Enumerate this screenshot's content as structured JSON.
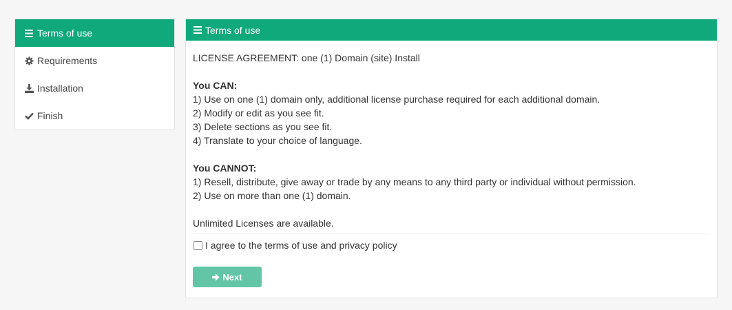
{
  "sidebar": {
    "items": [
      {
        "label": "Terms of use",
        "icon": "menu-icon",
        "active": true
      },
      {
        "label": "Requirements",
        "icon": "gear-icon",
        "active": false
      },
      {
        "label": "Installation",
        "icon": "download-icon",
        "active": false
      },
      {
        "label": "Finish",
        "icon": "check-icon",
        "active": false
      }
    ]
  },
  "panel": {
    "title": "Terms of use",
    "intro": "LICENSE AGREEMENT: one (1) Domain (site) Install",
    "can": {
      "heading": "You CAN:",
      "lines": [
        "1) Use on one (1) domain only, additional license purchase required for each additional domain.",
        "2) Modify or edit as you see fit.",
        "3) Delete sections as you see fit.",
        "4) Translate to your choice of language."
      ]
    },
    "cannot": {
      "heading": "You CANNOT:",
      "lines": [
        "1) Resell, distribute, give away or trade by any means to any third party or individual without permission.",
        "2) Use on more than one (1) domain."
      ]
    },
    "unlimited": "Unlimited Licenses are available.",
    "agree_label": "I agree to the terms of use and privacy policy",
    "agree_checked": false,
    "next_label": "Next"
  },
  "colors": {
    "accent": "#10a97c",
    "button_disabled": "#62c6a6",
    "background": "#f6f6f6"
  }
}
